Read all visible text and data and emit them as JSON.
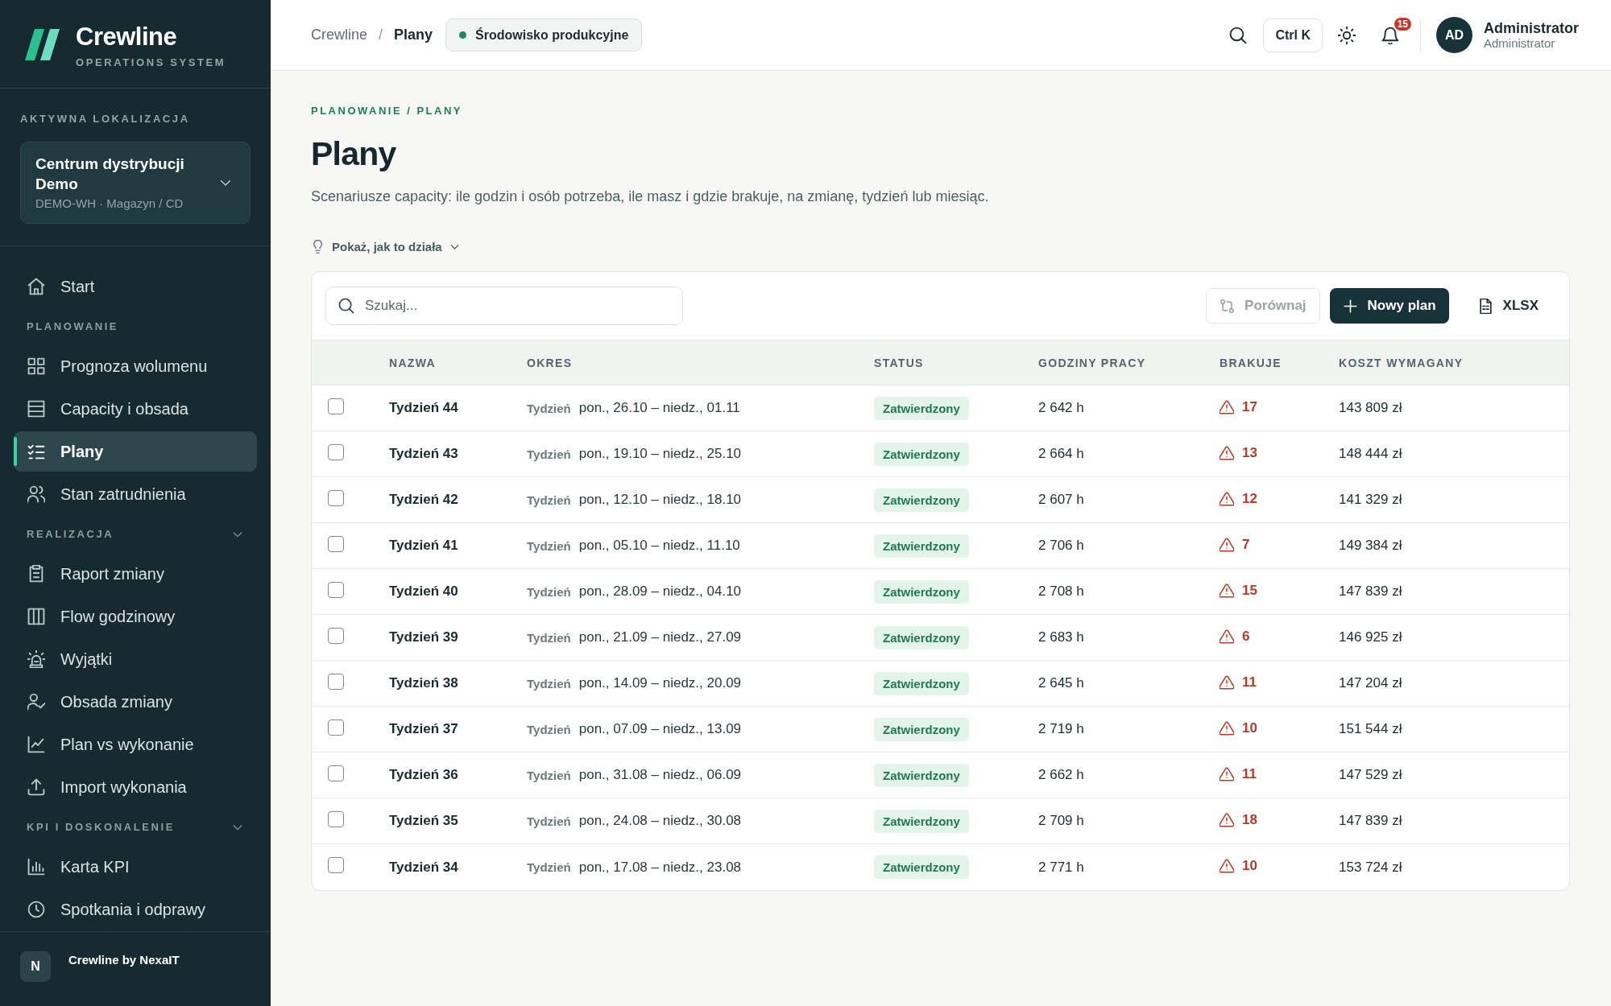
{
  "sidebar": {
    "brand": {
      "name": "Crewline",
      "tagline": "OPERATIONS SYSTEM"
    },
    "location": {
      "label": "AKTYWNA LOKALIZACJA",
      "name": "Centrum dystrybucji Demo",
      "detail": "DEMO-WH · Magazyn / CD"
    },
    "nav": [
      {
        "items": [
          {
            "label": "Start",
            "selected": false
          }
        ]
      },
      {
        "title": "PLANOWANIE",
        "items": [
          {
            "label": "Prognoza wolumenu",
            "selected": false
          },
          {
            "label": "Capacity i obsada",
            "selected": false
          },
          {
            "label": "Plany",
            "selected": true
          },
          {
            "label": "Stan zatrudnienia",
            "selected": false
          }
        ]
      },
      {
        "title": "REALIZACJA",
        "expanded": true,
        "items": [
          {
            "label": "Raport zmiany",
            "selected": false
          },
          {
            "label": "Flow godzinowy",
            "selected": false
          },
          {
            "label": "Wyjątki",
            "selected": false
          },
          {
            "label": "Obsada zmiany",
            "selected": false
          },
          {
            "label": "Plan vs wykonanie",
            "selected": false
          },
          {
            "label": "Import wykonania",
            "selected": false
          }
        ]
      },
      {
        "title": "KPI I DOSKONALENIE",
        "expanded": true,
        "items": [
          {
            "label": "Karta KPI",
            "selected": false
          },
          {
            "label": "Spotkania i odprawy",
            "selected": false
          }
        ]
      }
    ],
    "footer": {
      "initial": "N",
      "label": "Crewline by NexaIT"
    }
  },
  "topbar": {
    "breadcrumb": [
      {
        "label": "Crewline",
        "current": false
      },
      {
        "label": "Plany",
        "current": true
      }
    ],
    "separator": "/",
    "environment": "Środowisko produkcyjne",
    "shortcut": "Ctrl K",
    "notifications": "15",
    "user": {
      "initials": "AD",
      "name": "Administrator",
      "role": "Administrator"
    }
  },
  "page": {
    "kicker": "PLANOWANIE / PLANY",
    "title": "Plany",
    "description": "Scenariusze capacity: ile godzin i osób potrzeba, ile masz i gdzie brakuje, na zmianę, tydzień lub miesiąc.",
    "help_toggle": {
      "label": "Pokaż, jak to działa",
      "expanded": false
    }
  },
  "toolbar": {
    "search": {
      "placeholder": "Szukaj..."
    },
    "buttons": [
      {
        "kind": "secondary",
        "label": "Porównaj",
        "disabled": true
      },
      {
        "kind": "primary",
        "label": "Nowy plan",
        "disabled": false
      },
      {
        "kind": "ghost",
        "label": "XLSX",
        "disabled": false
      }
    ]
  },
  "table": {
    "columns": [
      "NAZWA",
      "OKRES",
      "STATUS",
      "GODZINY PRACY",
      "BRAKUJE",
      "KOSZT WYMAGANY"
    ],
    "rows": [
      {
        "checked": false,
        "name": "Tydzień 44",
        "period_unit": "Tydzień",
        "period": "pon., 26.10 – niedz., 01.11",
        "status": "Zatwierdzony",
        "hours": "2 642 h",
        "shortage": "17",
        "cost": "143 809 zł"
      },
      {
        "checked": false,
        "name": "Tydzień 43",
        "period_unit": "Tydzień",
        "period": "pon., 19.10 – niedz., 25.10",
        "status": "Zatwierdzony",
        "hours": "2 664 h",
        "shortage": "13",
        "cost": "148 444 zł"
      },
      {
        "checked": false,
        "name": "Tydzień 42",
        "period_unit": "Tydzień",
        "period": "pon., 12.10 – niedz., 18.10",
        "status": "Zatwierdzony",
        "hours": "2 607 h",
        "shortage": "12",
        "cost": "141 329 zł"
      },
      {
        "checked": false,
        "name": "Tydzień 41",
        "period_unit": "Tydzień",
        "period": "pon., 05.10 – niedz., 11.10",
        "status": "Zatwierdzony",
        "hours": "2 706 h",
        "shortage": "7",
        "cost": "149 384 zł"
      },
      {
        "checked": false,
        "name": "Tydzień 40",
        "period_unit": "Tydzień",
        "period": "pon., 28.09 – niedz., 04.10",
        "status": "Zatwierdzony",
        "hours": "2 708 h",
        "shortage": "15",
        "cost": "147 839 zł"
      },
      {
        "checked": false,
        "name": "Tydzień 39",
        "period_unit": "Tydzień",
        "period": "pon., 21.09 – niedz., 27.09",
        "status": "Zatwierdzony",
        "hours": "2 683 h",
        "shortage": "6",
        "cost": "146 925 zł"
      },
      {
        "checked": false,
        "name": "Tydzień 38",
        "period_unit": "Tydzień",
        "period": "pon., 14.09 – niedz., 20.09",
        "status": "Zatwierdzony",
        "hours": "2 645 h",
        "shortage": "11",
        "cost": "147 204 zł"
      },
      {
        "checked": false,
        "name": "Tydzień 37",
        "period_unit": "Tydzień",
        "period": "pon., 07.09 – niedz., 13.09",
        "status": "Zatwierdzony",
        "hours": "2 719 h",
        "shortage": "10",
        "cost": "151 544 zł"
      },
      {
        "checked": false,
        "name": "Tydzień 36",
        "period_unit": "Tydzień",
        "period": "pon., 31.08 – niedz., 06.09",
        "status": "Zatwierdzony",
        "hours": "2 662 h",
        "shortage": "11",
        "cost": "147 529 zł"
      },
      {
        "checked": false,
        "name": "Tydzień 35",
        "period_unit": "Tydzień",
        "period": "pon., 24.08 – niedz., 30.08",
        "status": "Zatwierdzony",
        "hours": "2 709 h",
        "shortage": "18",
        "cost": "147 839 zł"
      },
      {
        "checked": false,
        "name": "Tydzień 34",
        "period_unit": "Tydzień",
        "period": "pon., 17.08 – niedz., 23.08",
        "status": "Zatwierdzony",
        "hours": "2 771 h",
        "shortage": "10",
        "cost": "153 724 zł"
      }
    ]
  }
}
